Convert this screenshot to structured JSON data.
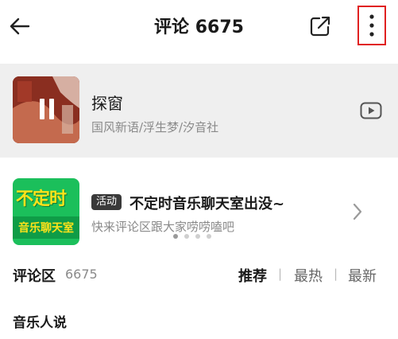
{
  "header": {
    "title": "评论 6675",
    "back_icon": "arrow-left-icon",
    "share_icon": "share-icon",
    "more_icon": "more-vertical-icon"
  },
  "song": {
    "title": "探窗",
    "artist": "国风新语/浮生梦/汐音社",
    "player_state": "pause-icon",
    "video_icon": "video-play-icon"
  },
  "banner": {
    "thumb_line1": "不定时",
    "thumb_line2": "音乐聊天室",
    "tag": "活动",
    "title": "不定时音乐聊天室出没~",
    "subtitle": "快来评论区跟大家唠唠嗑吧",
    "dots_total": 4,
    "dots_active": 1
  },
  "comments": {
    "title": "评论区",
    "count": "6675",
    "sort_tabs": [
      {
        "label": "推荐",
        "active": true
      },
      {
        "label": "最热",
        "active": false
      },
      {
        "label": "最新",
        "active": false
      }
    ],
    "separator": "|"
  },
  "section": {
    "title": "音乐人说"
  },
  "colors": {
    "highlight_border": "#e02020",
    "card_bg": "#efefef",
    "banner_green": "#1bbf5b",
    "banner_yellow": "#ffe21a"
  }
}
